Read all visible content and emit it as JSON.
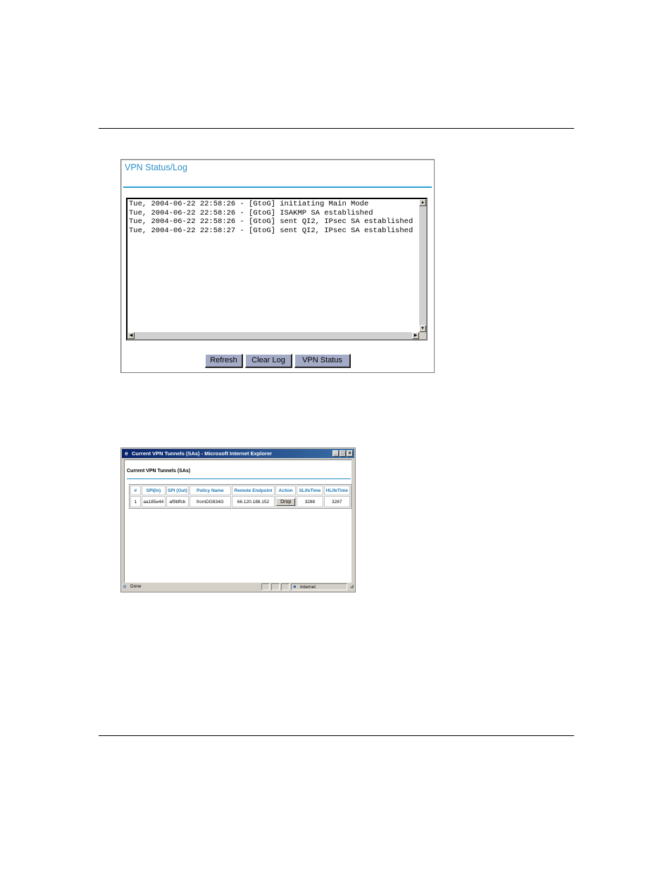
{
  "vpn_log": {
    "title": "VPN Status/Log",
    "log_text": "Tue, 2004-06-22 22:58:26 - [GtoG] initiating Main Mode\nTue, 2004-06-22 22:58:26 - [GtoG] ISAKMP SA established\nTue, 2004-06-22 22:58:26 - [GtoG] sent QI2, IPsec SA established\nTue, 2004-06-22 22:58:27 - [GtoG] sent QI2, IPsec SA established",
    "buttons": {
      "refresh": "Refresh",
      "clear_log": "Clear Log",
      "vpn_status": "VPN Status"
    }
  },
  "ie_window": {
    "title": "Current VPN Tunnels (SAs) - Microsoft Internet Explorer",
    "controls": {
      "minimize": "_",
      "maximize": "□",
      "close": "×"
    },
    "heading": "Current VPN Tunnels (SAs)",
    "table": {
      "headers": [
        "#",
        "SPI(In)",
        "SPI (Out)",
        "Policy Name",
        "Remote Endpoint",
        "Action",
        "SLifeTime",
        "HLifeTime"
      ],
      "rows": [
        [
          "1",
          "aa185e44",
          "af9bffcb",
          "fromDG834G",
          "66.120.188.152",
          "Drop",
          "3288",
          "3287"
        ]
      ]
    },
    "status": {
      "done": "Done",
      "zone": "Internet"
    }
  }
}
